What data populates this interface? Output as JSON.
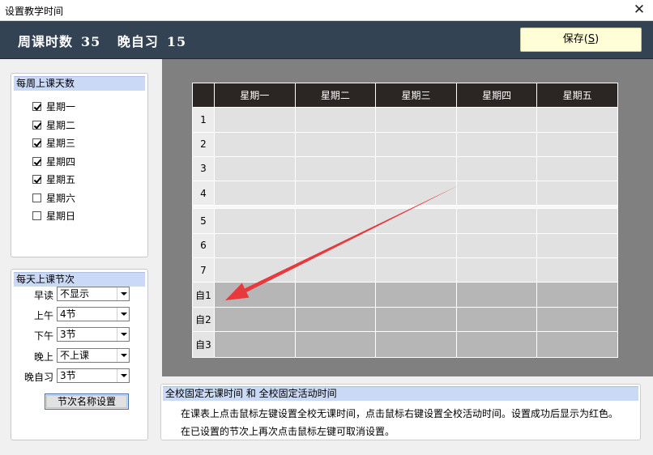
{
  "window": {
    "title": "设置教学时间",
    "close_label": "✕"
  },
  "header": {
    "weekly_label": "周课时数",
    "weekly_value": "35",
    "evening_label": "晚自习",
    "evening_value": "15",
    "save_label": "保存(",
    "save_key": "S",
    "save_suffix": ")"
  },
  "days_panel": {
    "title": "每周上课天数",
    "days": [
      {
        "label": "星期一",
        "checked": true
      },
      {
        "label": "星期二",
        "checked": true
      },
      {
        "label": "星期三",
        "checked": true
      },
      {
        "label": "星期四",
        "checked": true
      },
      {
        "label": "星期五",
        "checked": true
      },
      {
        "label": "星期六",
        "checked": false
      },
      {
        "label": "星期日",
        "checked": false
      }
    ]
  },
  "periods_panel": {
    "title": "每天上课节次",
    "rows": [
      {
        "label": "早读",
        "value": "不显示"
      },
      {
        "label": "上午",
        "value": "4节"
      },
      {
        "label": "下午",
        "value": "3节"
      },
      {
        "label": "晚上",
        "value": "不上课"
      },
      {
        "label": "晚自习",
        "value": "3节"
      }
    ],
    "rename_button": "节次名称设置"
  },
  "grid": {
    "columns": [
      "星期一",
      "星期二",
      "星期三",
      "星期四",
      "星期五"
    ],
    "rows": [
      "1",
      "2",
      "3",
      "4",
      "5",
      "6",
      "7",
      "自1",
      "自2",
      "自3"
    ]
  },
  "notes": {
    "title": "全校固定无课时间 和 全校固定活动时间",
    "line1": "在课表上点击鼠标左键设置全校无课时间，点击鼠标右键设置全校活动时间。设置成功后显示为红色。",
    "line2": "在已设置的节次上再次点击鼠标左键可取消设置。"
  },
  "colors": {
    "header_bg": "#344354",
    "annotation_arrow": "#e8393d",
    "group_title_bg": "#cad9f5"
  }
}
